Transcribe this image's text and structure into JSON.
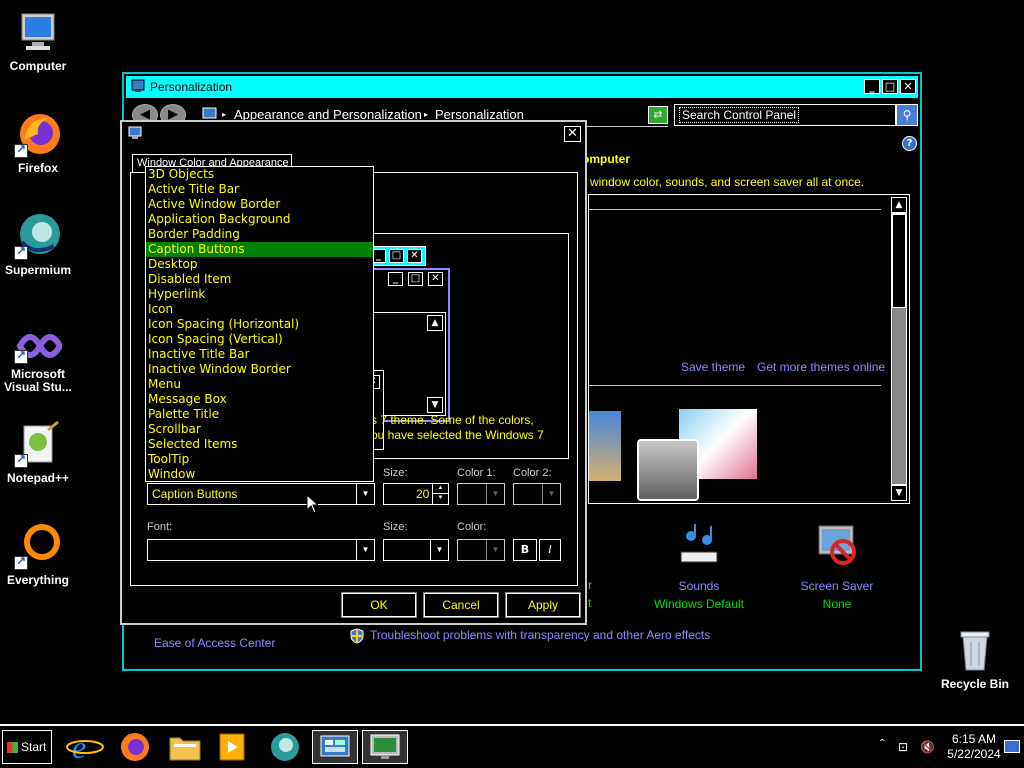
{
  "desktop": {
    "icons": [
      {
        "label": "Computer"
      },
      {
        "label": "Firefox"
      },
      {
        "label": "Supermium"
      },
      {
        "label": "Microsoft Visual Stu..."
      },
      {
        "label": "Notepad++"
      },
      {
        "label": "Everything"
      },
      {
        "label": "Recycle Bin"
      }
    ]
  },
  "main_window": {
    "title": "Personalization",
    "breadcrumb": [
      "Appearance and Personalization",
      "Personalization"
    ],
    "search_placeholder": "Search Control Panel",
    "heading_fragment": "omputer",
    "subtext_fragment": "window color, sounds, and screen saver all at once.",
    "save_theme": "Save theme",
    "get_more_themes": "Get more themes online",
    "sounds_label": "Sounds",
    "sounds_value": "Windows Default",
    "screensaver_label": "Screen Saver",
    "screensaver_value": "None",
    "color_value_fragment": "t",
    "color_label_fragment": "r",
    "ease_of_access": "Ease of Access Center",
    "troubleshoot": "Troubleshoot problems with transparency and other Aero effects"
  },
  "dialog": {
    "tab_label": "Window Color and Appearance",
    "info_line1": "s 7 theme.  Some of the colors,",
    "info_line2": "ou have selected the Windows 7",
    "item_value": "Caption Buttons",
    "size_label": "Size:",
    "size_value": "20",
    "color1_label": "Color 1:",
    "color2_label": "Color 2:",
    "font_label": "Font:",
    "font_size_label": "Size:",
    "font_color_label": "Color:",
    "bold_label": "B",
    "italic_label": "I",
    "ok_label": "OK",
    "cancel_label": "Cancel",
    "apply_label": "Apply"
  },
  "dropdown": {
    "items": [
      "3D Objects",
      "Active Title Bar",
      "Active Window Border",
      "Application Background",
      "Border Padding",
      "Caption Buttons",
      "Desktop",
      "Disabled Item",
      "Hyperlink",
      "Icon",
      "Icon Spacing (Horizontal)",
      "Icon Spacing (Vertical)",
      "Inactive Title Bar",
      "Inactive Window Border",
      "Menu",
      "Message Box",
      "Palette Title",
      "Scrollbar",
      "Selected Items",
      "ToolTip",
      "Window"
    ],
    "selected": "Caption Buttons"
  },
  "taskbar": {
    "start_label": "Start",
    "time": "6:15 AM",
    "date": "5/22/2024"
  },
  "colors": {
    "titlebar": "#00ffff",
    "highlight": "#008000",
    "text": "#ffff00",
    "link": "#8a8aff"
  }
}
